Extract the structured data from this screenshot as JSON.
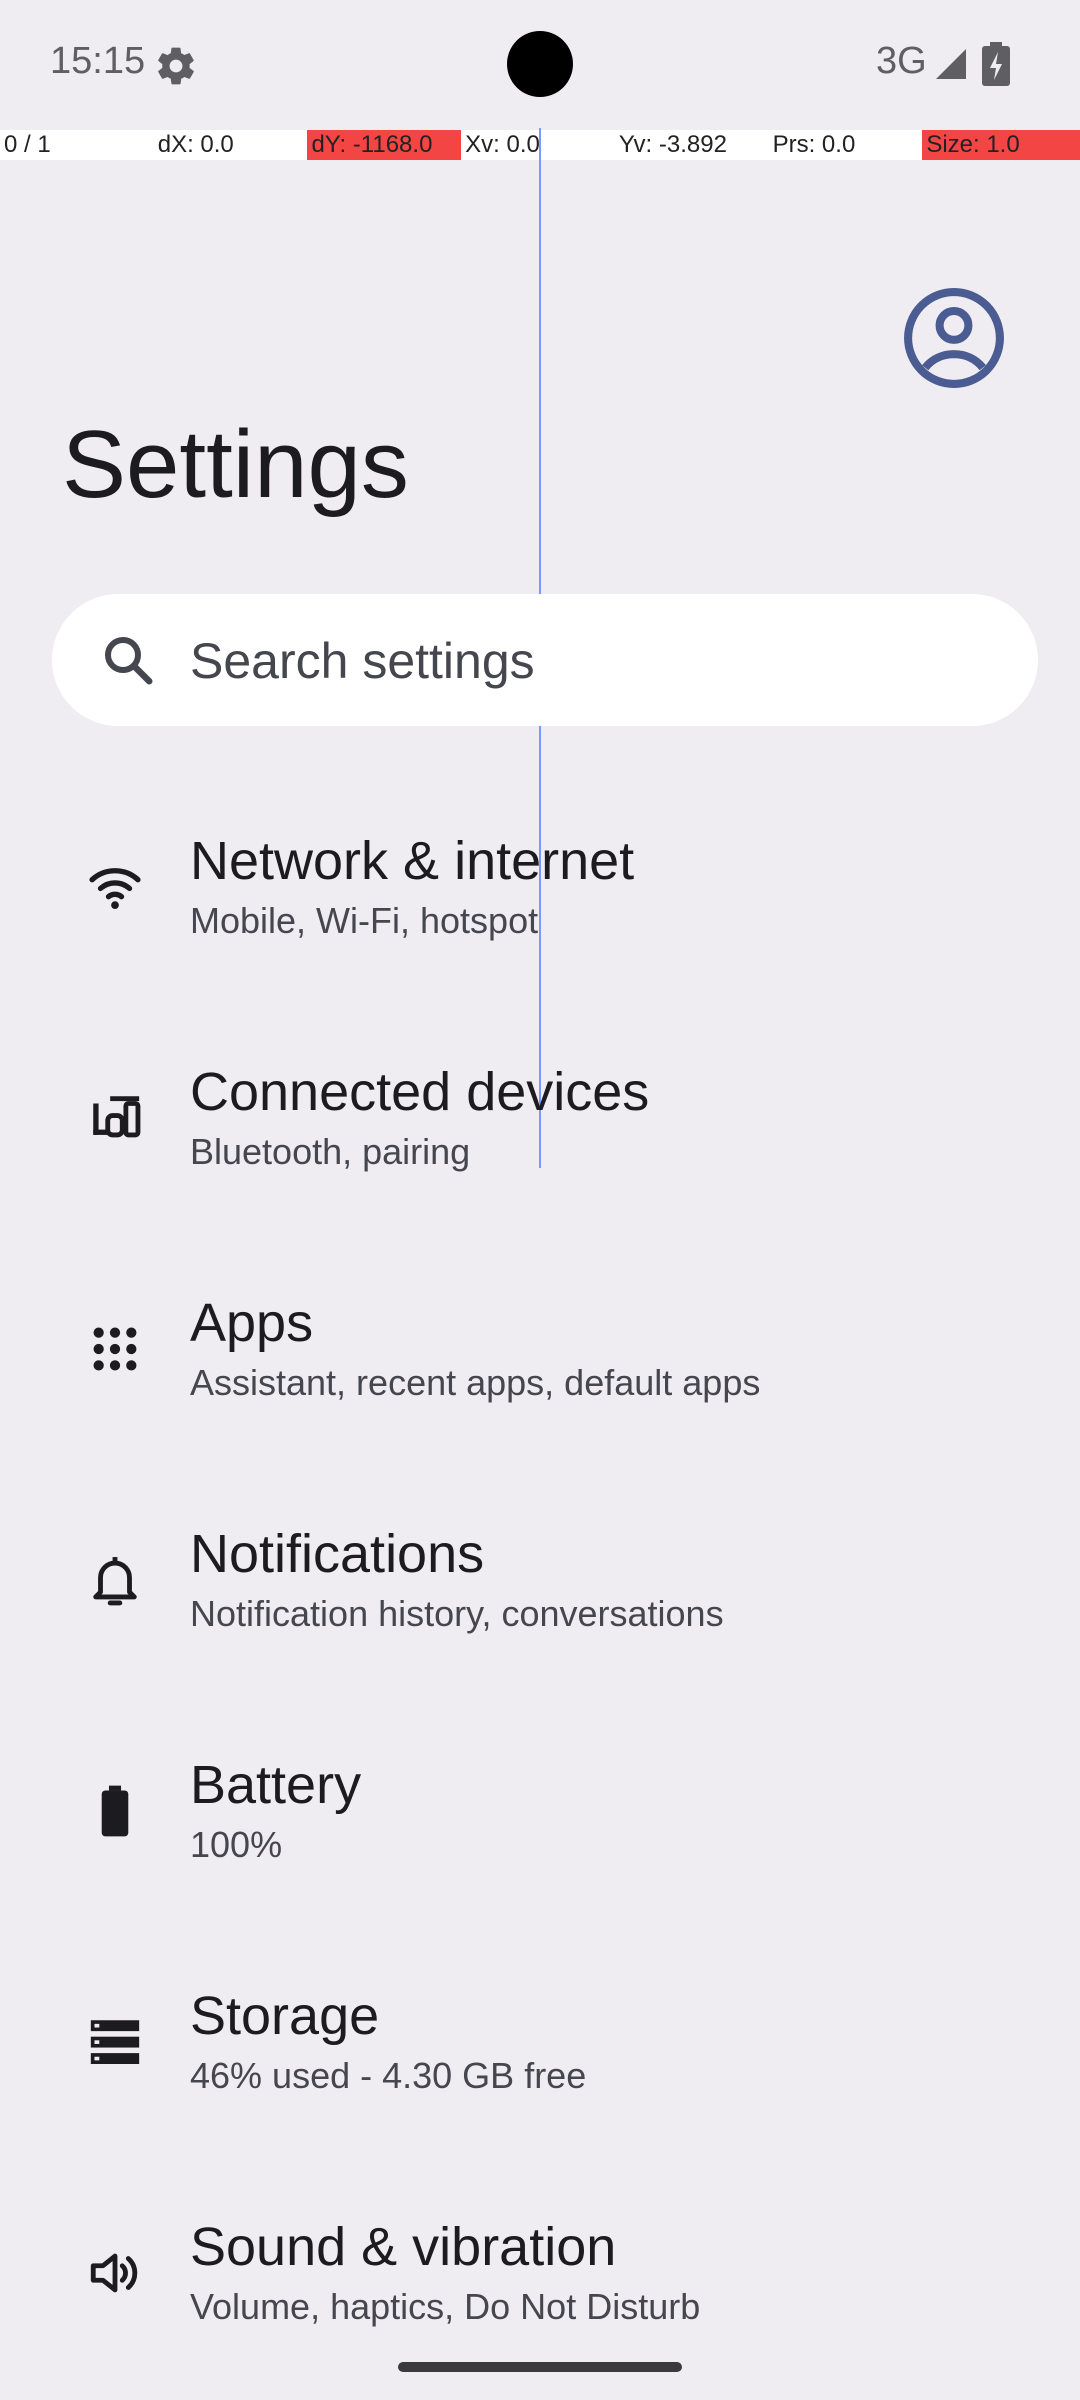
{
  "status_bar": {
    "time": "15:15",
    "network": "3G",
    "icons": [
      "gear-icon",
      "signal-icon",
      "battery-charging-icon"
    ]
  },
  "debug_bar": {
    "pointer": "0 / 1",
    "dx": "dX: 0.0",
    "dy": "dY: -1168.0",
    "xv": "Xv: 0.0",
    "yv": "Yv: -3.892",
    "prs": "Prs: 0.0",
    "size": "Size: 1.0"
  },
  "header": {
    "title": "Settings",
    "avatar_icon": "account-circle-icon"
  },
  "search": {
    "placeholder": "Search settings",
    "icon": "search-icon"
  },
  "settings": [
    {
      "id": "network",
      "title": "Network & internet",
      "subtitle": "Mobile, Wi-Fi, hotspot",
      "icon": "wifi-icon"
    },
    {
      "id": "connected-devices",
      "title": "Connected devices",
      "subtitle": "Bluetooth, pairing",
      "icon": "devices-icon"
    },
    {
      "id": "apps",
      "title": "Apps",
      "subtitle": "Assistant, recent apps, default apps",
      "icon": "apps-grid-icon"
    },
    {
      "id": "notifications",
      "title": "Notifications",
      "subtitle": "Notification history, conversations",
      "icon": "bell-icon"
    },
    {
      "id": "battery",
      "title": "Battery",
      "subtitle": "100%",
      "icon": "battery-icon"
    },
    {
      "id": "storage",
      "title": "Storage",
      "subtitle": "46% used - 4.30 GB free",
      "icon": "storage-icon"
    },
    {
      "id": "sound",
      "title": "Sound & vibration",
      "subtitle": "Volume, haptics, Do Not Disturb",
      "icon": "volume-icon"
    }
  ],
  "colors": {
    "background": "#f0edf2",
    "accent": "#4a5c92",
    "debug_highlight": "#f44545"
  }
}
